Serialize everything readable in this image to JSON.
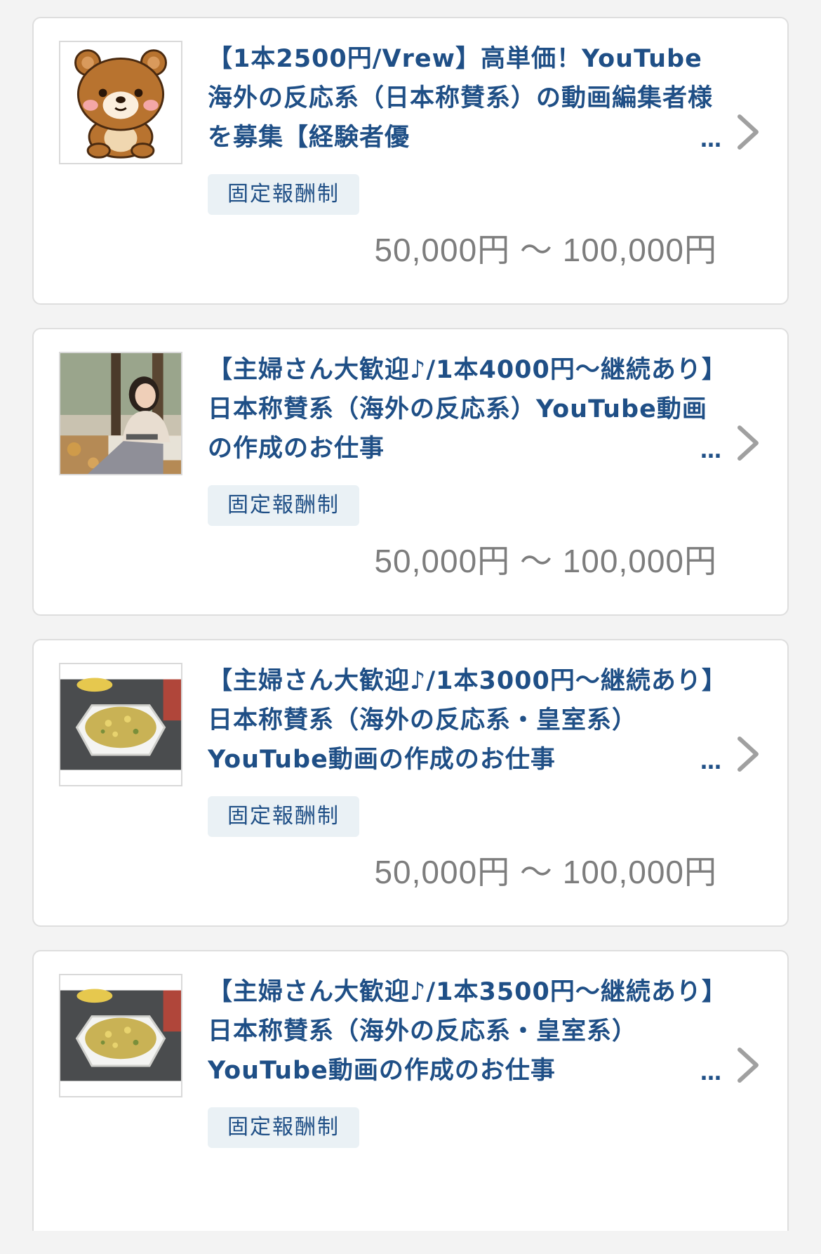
{
  "jobs": [
    {
      "title": "【1本2500円/Vrew】高単価！YouTube海外の反応系（日本称賛系）の動画編集者様を募集【経験者優",
      "ellipsis": "…",
      "badge": "固定報酬制",
      "price": "50,000円 〜 100,000円",
      "thumbnail": "bear-mascot"
    },
    {
      "title": "【主婦さん大歓迎♪/1本4000円〜継続あり】日本称賛系（海外の反応系）YouTube動画の作成のお仕事",
      "ellipsis": "…",
      "badge": "固定報酬制",
      "price": "50,000円 〜 100,000円",
      "thumbnail": "woman-photo"
    },
    {
      "title": "【主婦さん大歓迎♪/1本3000円〜継続あり】日本称賛系（海外の反応系・皇室系）YouTube動画の作成のお仕事",
      "ellipsis": "…",
      "badge": "固定報酬制",
      "price": "50,000円 〜 100,000円",
      "thumbnail": "fried-rice-photo"
    },
    {
      "title": "【主婦さん大歓迎♪/1本3500円〜継続あり】日本称賛系（海外の反応系・皇室系）YouTube動画の作成のお仕事",
      "ellipsis": "…",
      "badge": "固定報酬制",
      "thumbnail": "fried-rice-photo"
    }
  ],
  "colors": {
    "title": "#1f4f86",
    "badge_bg": "#eaf1f5",
    "price": "#7d7d7d",
    "chevron": "#a0a0a0",
    "card_border": "#dedede"
  },
  "icons": {
    "chevron": "chevron-right-icon"
  }
}
